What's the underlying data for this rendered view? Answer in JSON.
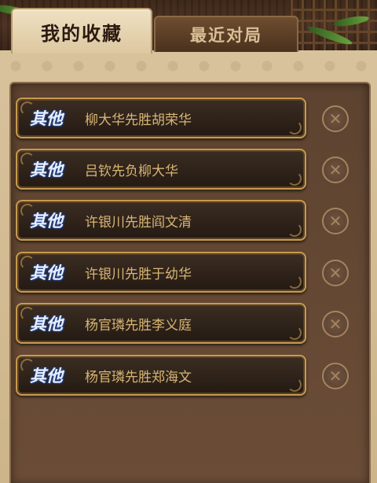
{
  "tabs": [
    {
      "label": "我的收藏",
      "active": true
    },
    {
      "label": "最近对局",
      "active": false
    }
  ],
  "favorites": [
    {
      "tag": "其他",
      "title": "柳大华先胜胡荣华"
    },
    {
      "tag": "其他",
      "title": "吕钦先负柳大华"
    },
    {
      "tag": "其他",
      "title": "许银川先胜阎文清"
    },
    {
      "tag": "其他",
      "title": "许银川先胜于幼华"
    },
    {
      "tag": "其他",
      "title": "杨官璘先胜李义庭"
    },
    {
      "tag": "其他",
      "title": "杨官璘先胜郑海文"
    }
  ],
  "icons": {
    "delete": "close-circle-icon"
  }
}
